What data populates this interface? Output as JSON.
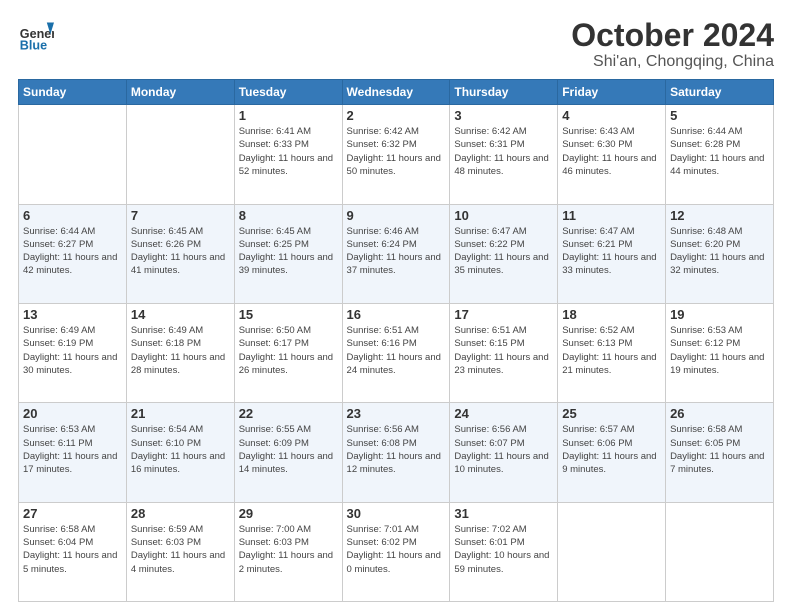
{
  "logo": {
    "general": "General",
    "blue": "Blue"
  },
  "header": {
    "month": "October 2024",
    "location": "Shi'an, Chongqing, China"
  },
  "weekdays": [
    "Sunday",
    "Monday",
    "Tuesday",
    "Wednesday",
    "Thursday",
    "Friday",
    "Saturday"
  ],
  "weeks": [
    [
      null,
      null,
      {
        "day": "1",
        "sunrise": "6:41 AM",
        "sunset": "6:33 PM",
        "daylight": "11 hours and 52 minutes."
      },
      {
        "day": "2",
        "sunrise": "6:42 AM",
        "sunset": "6:32 PM",
        "daylight": "11 hours and 50 minutes."
      },
      {
        "day": "3",
        "sunrise": "6:42 AM",
        "sunset": "6:31 PM",
        "daylight": "11 hours and 48 minutes."
      },
      {
        "day": "4",
        "sunrise": "6:43 AM",
        "sunset": "6:30 PM",
        "daylight": "11 hours and 46 minutes."
      },
      {
        "day": "5",
        "sunrise": "6:44 AM",
        "sunset": "6:28 PM",
        "daylight": "11 hours and 44 minutes."
      }
    ],
    [
      {
        "day": "6",
        "sunrise": "6:44 AM",
        "sunset": "6:27 PM",
        "daylight": "11 hours and 42 minutes."
      },
      {
        "day": "7",
        "sunrise": "6:45 AM",
        "sunset": "6:26 PM",
        "daylight": "11 hours and 41 minutes."
      },
      {
        "day": "8",
        "sunrise": "6:45 AM",
        "sunset": "6:25 PM",
        "daylight": "11 hours and 39 minutes."
      },
      {
        "day": "9",
        "sunrise": "6:46 AM",
        "sunset": "6:24 PM",
        "daylight": "11 hours and 37 minutes."
      },
      {
        "day": "10",
        "sunrise": "6:47 AM",
        "sunset": "6:22 PM",
        "daylight": "11 hours and 35 minutes."
      },
      {
        "day": "11",
        "sunrise": "6:47 AM",
        "sunset": "6:21 PM",
        "daylight": "11 hours and 33 minutes."
      },
      {
        "day": "12",
        "sunrise": "6:48 AM",
        "sunset": "6:20 PM",
        "daylight": "11 hours and 32 minutes."
      }
    ],
    [
      {
        "day": "13",
        "sunrise": "6:49 AM",
        "sunset": "6:19 PM",
        "daylight": "11 hours and 30 minutes."
      },
      {
        "day": "14",
        "sunrise": "6:49 AM",
        "sunset": "6:18 PM",
        "daylight": "11 hours and 28 minutes."
      },
      {
        "day": "15",
        "sunrise": "6:50 AM",
        "sunset": "6:17 PM",
        "daylight": "11 hours and 26 minutes."
      },
      {
        "day": "16",
        "sunrise": "6:51 AM",
        "sunset": "6:16 PM",
        "daylight": "11 hours and 24 minutes."
      },
      {
        "day": "17",
        "sunrise": "6:51 AM",
        "sunset": "6:15 PM",
        "daylight": "11 hours and 23 minutes."
      },
      {
        "day": "18",
        "sunrise": "6:52 AM",
        "sunset": "6:13 PM",
        "daylight": "11 hours and 21 minutes."
      },
      {
        "day": "19",
        "sunrise": "6:53 AM",
        "sunset": "6:12 PM",
        "daylight": "11 hours and 19 minutes."
      }
    ],
    [
      {
        "day": "20",
        "sunrise": "6:53 AM",
        "sunset": "6:11 PM",
        "daylight": "11 hours and 17 minutes."
      },
      {
        "day": "21",
        "sunrise": "6:54 AM",
        "sunset": "6:10 PM",
        "daylight": "11 hours and 16 minutes."
      },
      {
        "day": "22",
        "sunrise": "6:55 AM",
        "sunset": "6:09 PM",
        "daylight": "11 hours and 14 minutes."
      },
      {
        "day": "23",
        "sunrise": "6:56 AM",
        "sunset": "6:08 PM",
        "daylight": "11 hours and 12 minutes."
      },
      {
        "day": "24",
        "sunrise": "6:56 AM",
        "sunset": "6:07 PM",
        "daylight": "11 hours and 10 minutes."
      },
      {
        "day": "25",
        "sunrise": "6:57 AM",
        "sunset": "6:06 PM",
        "daylight": "11 hours and 9 minutes."
      },
      {
        "day": "26",
        "sunrise": "6:58 AM",
        "sunset": "6:05 PM",
        "daylight": "11 hours and 7 minutes."
      }
    ],
    [
      {
        "day": "27",
        "sunrise": "6:58 AM",
        "sunset": "6:04 PM",
        "daylight": "11 hours and 5 minutes."
      },
      {
        "day": "28",
        "sunrise": "6:59 AM",
        "sunset": "6:03 PM",
        "daylight": "11 hours and 4 minutes."
      },
      {
        "day": "29",
        "sunrise": "7:00 AM",
        "sunset": "6:03 PM",
        "daylight": "11 hours and 2 minutes."
      },
      {
        "day": "30",
        "sunrise": "7:01 AM",
        "sunset": "6:02 PM",
        "daylight": "11 hours and 0 minutes."
      },
      {
        "day": "31",
        "sunrise": "7:02 AM",
        "sunset": "6:01 PM",
        "daylight": "10 hours and 59 minutes."
      },
      null,
      null
    ]
  ]
}
